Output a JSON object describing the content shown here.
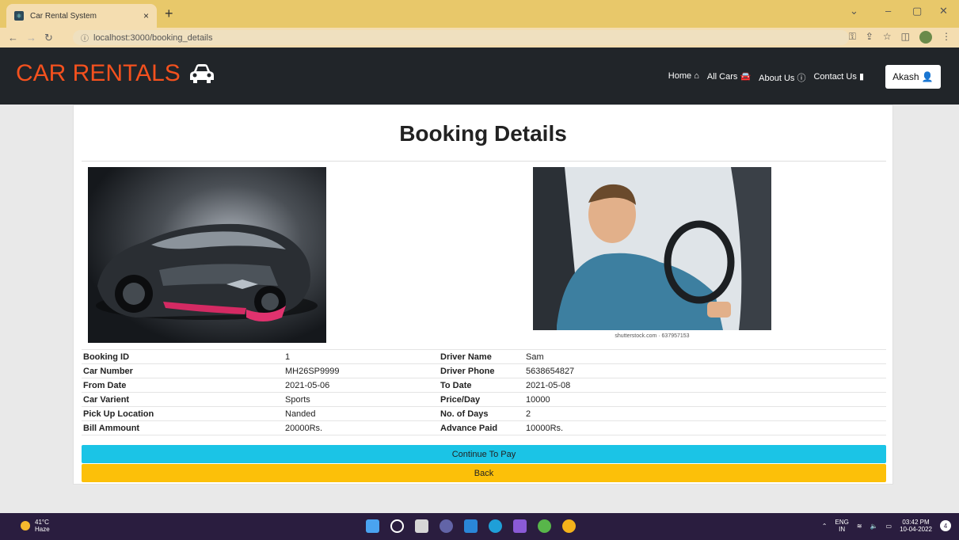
{
  "browser": {
    "tab_title": "Car Rental System",
    "tab_close": "×",
    "new_tab": "+",
    "url": "localhost:3000/booking_details",
    "win_minimize": "–",
    "win_restore": "▢",
    "win_close": "✕",
    "tab_menu": "⌄"
  },
  "navbar": {
    "brand": "CAR RENTALS",
    "links": [
      {
        "label": "Home"
      },
      {
        "label": "All Cars"
      },
      {
        "label": "About Us"
      },
      {
        "label": "Contact Us"
      }
    ],
    "user": "Akash"
  },
  "page": {
    "title": "Booking Details",
    "image_credit": "shutterstock.com · 637957153"
  },
  "details": [
    {
      "k1": "Booking ID",
      "v1": "1",
      "k2": "Driver Name",
      "v2": "Sam"
    },
    {
      "k1": "Car Number",
      "v1": "MH26SP9999",
      "k2": "Driver Phone",
      "v2": "5638654827"
    },
    {
      "k1": "From Date",
      "v1": "2021-05-06",
      "k2": "To Date",
      "v2": "2021-05-08"
    },
    {
      "k1": "Car Varient",
      "v1": "Sports",
      "k2": "Price/Day",
      "v2": "10000"
    },
    {
      "k1": "Pick Up Location",
      "v1": "Nanded",
      "k2": "No. of Days",
      "v2": "2"
    },
    {
      "k1": "Bill Ammount",
      "v1": "20000Rs.",
      "k2": "Advance Paid",
      "v2": "10000Rs."
    }
  ],
  "buttons": {
    "pay": "Continue To Pay",
    "back": "Back"
  },
  "taskbar": {
    "temp": "41°C",
    "weather": "Haze",
    "lang1": "ENG",
    "lang2": "IN",
    "time": "03:42 PM",
    "date": "10-04-2022",
    "notif": "4"
  },
  "colors": {
    "brand": "#f4511e",
    "navbar": "#212529",
    "pay": "#1bc4e6",
    "back": "#fcc009"
  }
}
